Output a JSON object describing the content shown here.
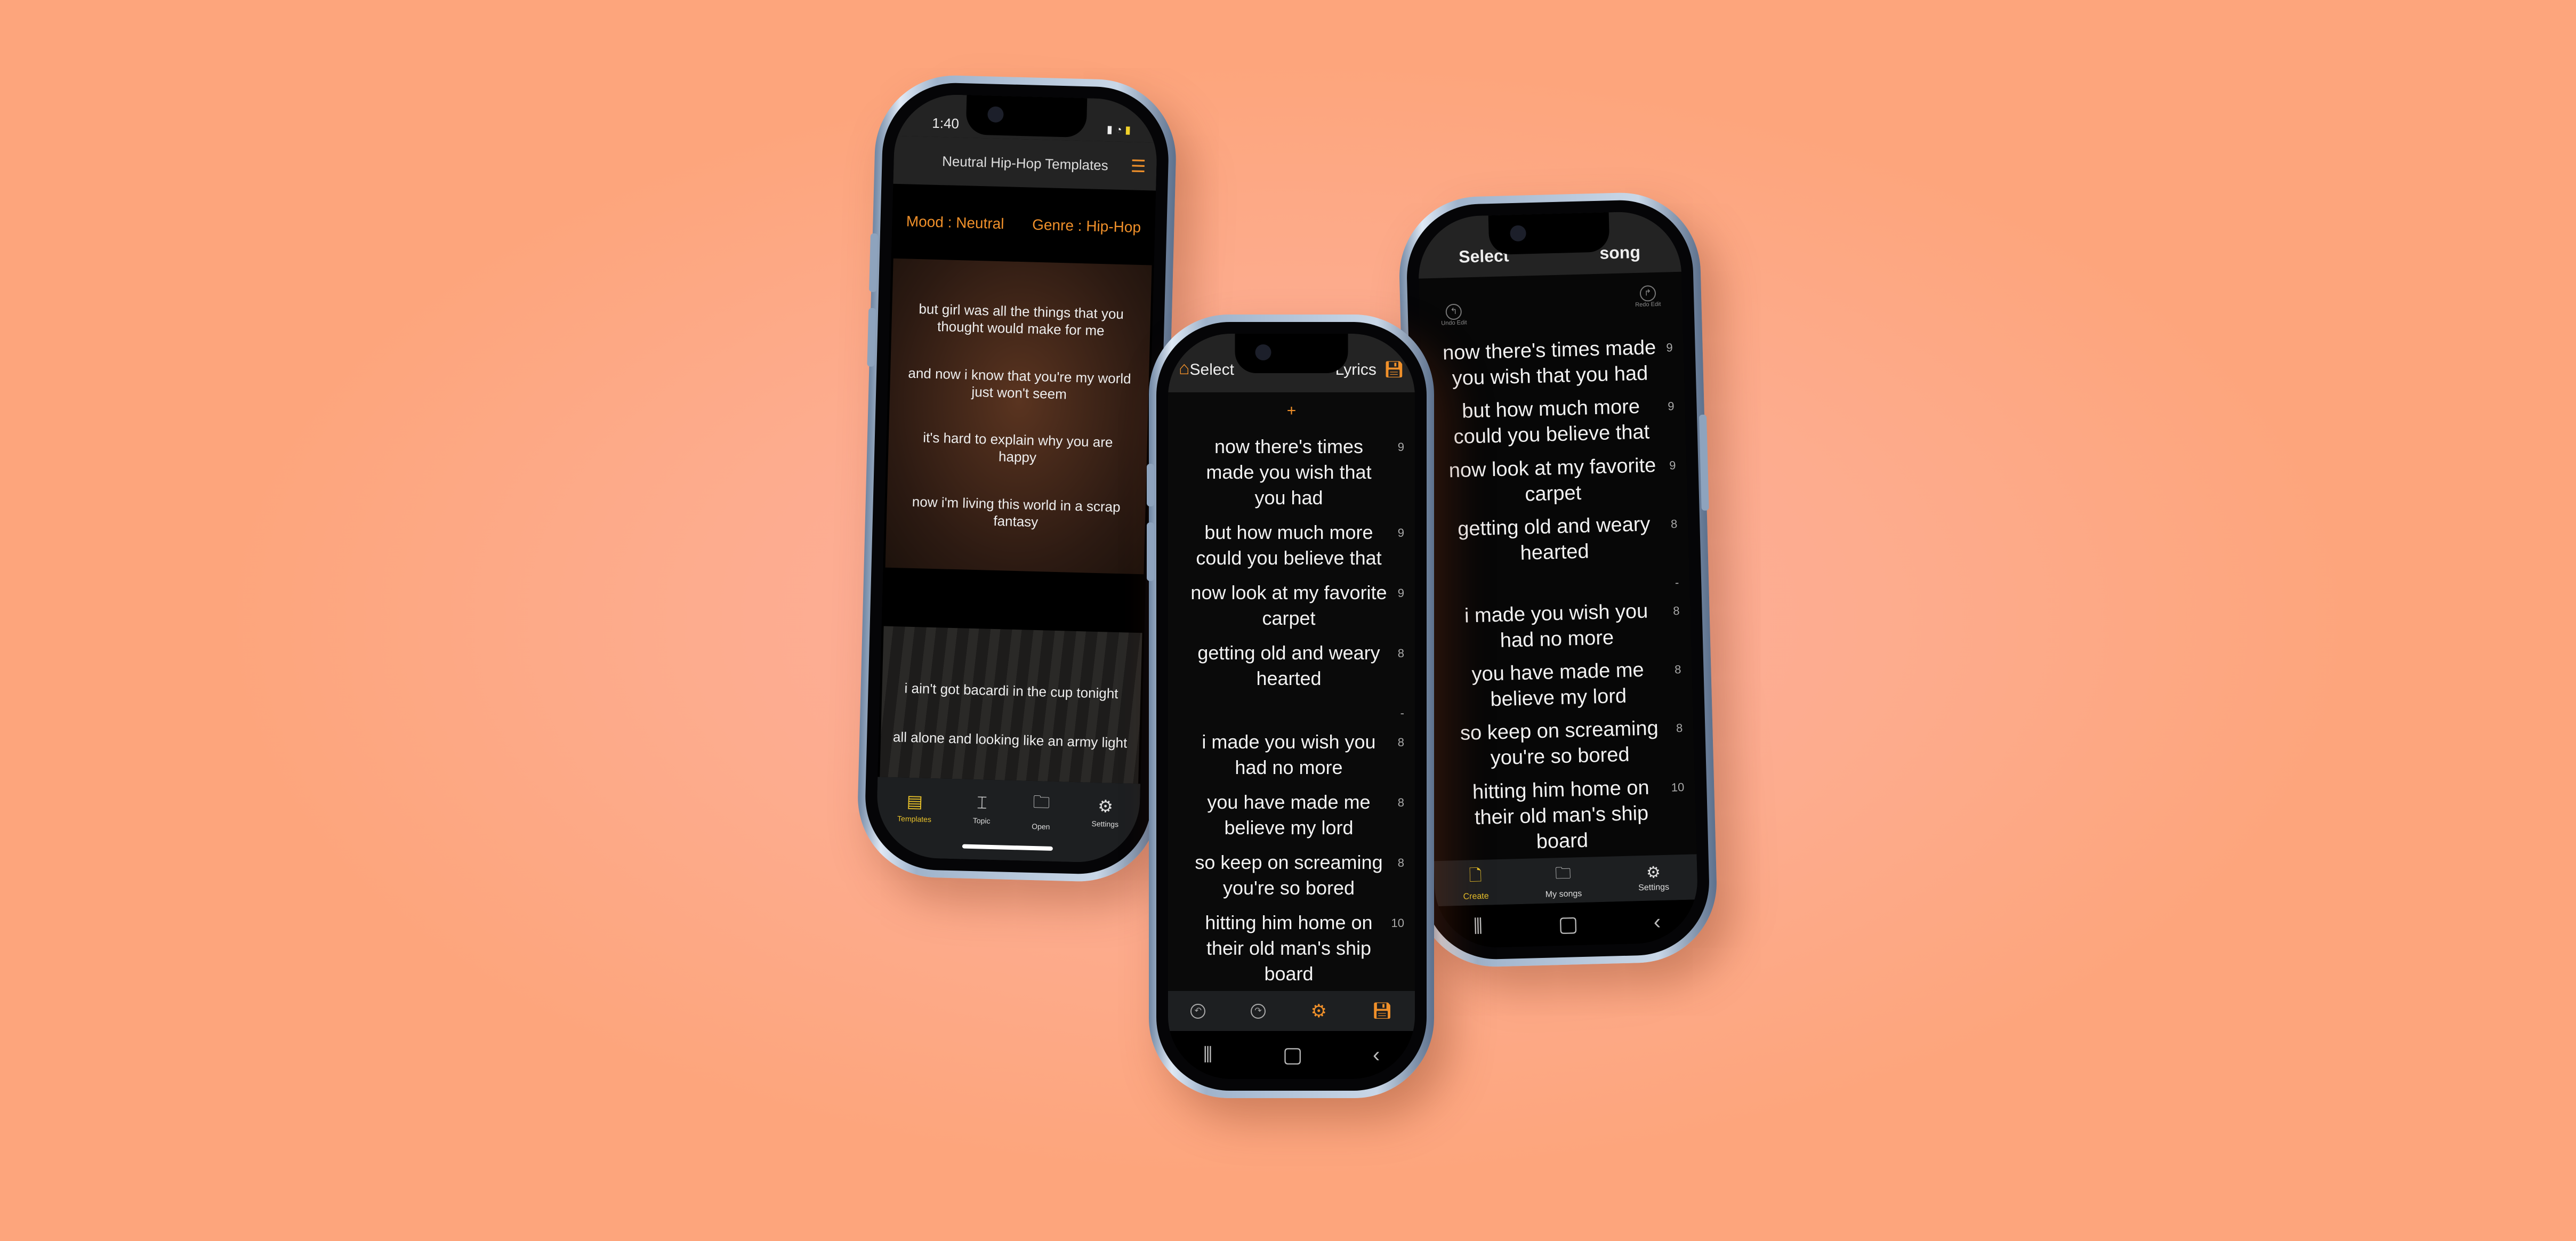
{
  "colors": {
    "accent": "#f0902a",
    "tab_active": "#e8c12a",
    "background": "#fdac8e"
  },
  "templates_phone": {
    "status": {
      "time": "1:40"
    },
    "title": "Neutral Hip-Hop Templates",
    "mood": "Mood : Neutral",
    "genre": "Genre : Hip-Hop",
    "cards": [
      {
        "lines": [
          "but girl was all the things that you thought would make for me",
          "and now i know that you're my world just won't seem",
          "it's hard to explain why you are happy",
          "now i'm living this world in a scrap fantasy"
        ]
      },
      {
        "lines": [
          "i ain't got bacardi in the cup tonight",
          "all alone and looking like an army light"
        ]
      }
    ],
    "tabs": [
      {
        "label": "Templates",
        "icon": "templates-icon",
        "active": true
      },
      {
        "label": "Topic",
        "icon": "topic-icon"
      },
      {
        "label": "Open",
        "icon": "folder-icon"
      },
      {
        "label": "Settings",
        "icon": "gear-icon"
      }
    ]
  },
  "lyrics_phone": {
    "title_left": "Select",
    "title_right": "Lyrics",
    "add_label": "+",
    "lines": [
      {
        "text": "now there's times made you wish that you had",
        "count": "9"
      },
      {
        "text": "but how much more could you believe that",
        "count": "9"
      },
      {
        "text": "now look at my favorite carpet",
        "count": "9"
      },
      {
        "text": "getting old and weary hearted",
        "count": "8"
      },
      {
        "text": "",
        "count": "-"
      },
      {
        "text": "i made you wish you had no more",
        "count": "8"
      },
      {
        "text": "you have made me believe my lord",
        "count": "8"
      },
      {
        "text": "so keep on screaming you're so bored",
        "count": "8"
      },
      {
        "text": "hitting him home on their old man's ship board",
        "count": "10"
      }
    ]
  },
  "song_phone": {
    "title_left": "Select",
    "title_right": "song",
    "undo_label": "Undo Edit",
    "redo_label": "Redo Edit",
    "lines": [
      {
        "text": "now there's times made you wish that you had",
        "count": "9"
      },
      {
        "text": "but how much more could you believe that",
        "count": "9"
      },
      {
        "text": "now look at my favorite carpet",
        "count": "9"
      },
      {
        "text": "getting old and weary hearted",
        "count": "8"
      },
      {
        "text": "",
        "count": "-"
      },
      {
        "text": "i made you wish you had no more",
        "count": "8"
      },
      {
        "text": "you have made me believe my lord",
        "count": "8"
      },
      {
        "text": "so keep on screaming you're so bored",
        "count": "8"
      },
      {
        "text": "hitting him home on their old man's ship board",
        "count": "10"
      }
    ],
    "tabs": [
      {
        "label": "Create",
        "icon": "create-file-icon",
        "active": true
      },
      {
        "label": "My songs",
        "icon": "folder-icon"
      },
      {
        "label": "Settings",
        "icon": "gear-icon"
      }
    ]
  }
}
